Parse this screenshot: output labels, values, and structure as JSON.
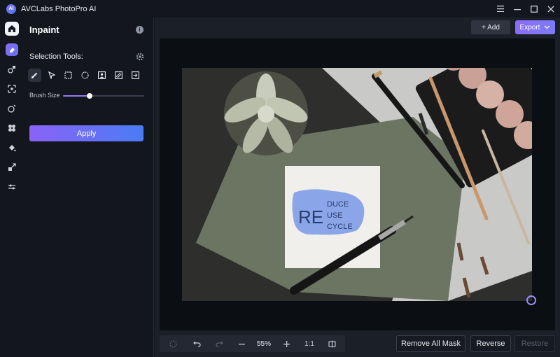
{
  "app": {
    "title": "AVCLabs PhotoPro AI",
    "logo_text": "AI"
  },
  "window_controls": {
    "menu_icon": "menu-icon",
    "minimize_icon": "minimize-icon",
    "maximize_icon": "maximize-icon",
    "close_icon": "close-icon"
  },
  "rail": {
    "items": [
      {
        "name": "home-icon"
      },
      {
        "name": "inpaint-icon"
      },
      {
        "name": "enhance-icon"
      },
      {
        "name": "remove-object-icon"
      },
      {
        "name": "face-icon"
      },
      {
        "name": "background-icon"
      },
      {
        "name": "colorize-icon"
      },
      {
        "name": "upscale-icon"
      },
      {
        "name": "adjust-icon"
      }
    ]
  },
  "panel": {
    "title": "Inpaint",
    "selection_label": "Selection Tools:",
    "tools": [
      "brush-icon",
      "polygon-icon",
      "rectangle-icon",
      "ellipse-icon",
      "person-select-icon",
      "pattern-select-icon",
      "import-mask-icon"
    ],
    "brush_size_label": "Brush Size",
    "brush_size_value": 0.33,
    "apply_label": "Apply"
  },
  "toolbar": {
    "add_label": "+ Add",
    "export_label": "Export"
  },
  "photo": {
    "card_lines": [
      "RE",
      "DUCE",
      "USE",
      "CYCLE"
    ]
  },
  "bottom": {
    "zoom": "55%",
    "ratio": "1:1",
    "remove_all_mask": "Remove All Mask",
    "reverse": "Reverse",
    "restore": "Restore"
  },
  "colors": {
    "accent": "#8a63f5",
    "accent2": "#4a7bf6"
  }
}
